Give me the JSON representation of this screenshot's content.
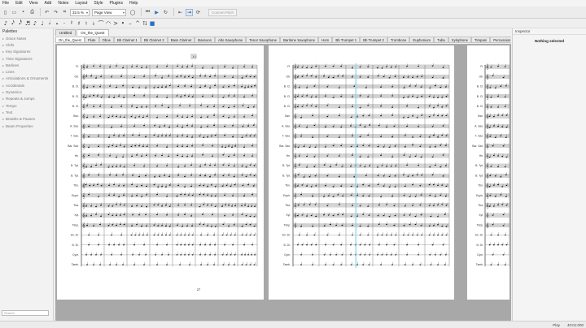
{
  "menu": [
    "File",
    "Edit",
    "View",
    "Add",
    "Notes",
    "Layout",
    "Style",
    "Plugins",
    "Help"
  ],
  "toolbar": {
    "zoom": "32.5 %",
    "view_mode": "Page View",
    "concert_pitch": "Concert Pitch"
  },
  "palette": {
    "title": "Palettes",
    "items": [
      "Grace Notes",
      "Clefs",
      "Key Signatures",
      "Time Signatures",
      "Barlines",
      "Lines",
      "Articulations & Ornaments",
      "Accidentals",
      "Dynamics",
      "Repeats & Jumps",
      "Tempo",
      "Text",
      "Breaths & Pauses",
      "Beam Properties"
    ],
    "search": "Search"
  },
  "score_tabs": [
    "Untitled",
    "On_the_Quest"
  ],
  "part_tabs": [
    "On_the_Quest",
    "Flute",
    "Oboe",
    "Bb Clarinet 1",
    "Bb Clarinet 2",
    "Bass Clarinet",
    "Bassoon",
    "Alto Saxophone",
    "Tenor Saxophone",
    "Baritone Saxophone",
    "Horn",
    "Bb Trumpet 1",
    "Bb Trumpet 2",
    "Trombone",
    "Euphonium",
    "Tuba",
    "Xylophone",
    "Timpani",
    "Percussion 2",
    "Percussion 3"
  ],
  "instruments": [
    "Fl.",
    "Ob.",
    "B. Cl.",
    "B. Cl.",
    "B. Cl.",
    "Bsn.",
    "A. Sax.",
    "T. Sax.",
    "Bar. Sax.",
    "Hn.",
    "B. Tpt.",
    "B. Tpt.",
    "Tbn.",
    "Euph.",
    "Tba.",
    "Xyl.",
    "Timp.",
    "Sn. Dr.",
    "B. Dr.",
    "Cym.",
    "Tamb."
  ],
  "page1_rehearsal": "30",
  "page1_number": "27",
  "inspector": {
    "title": "Inspector",
    "nothing_selected": "Nothing selected"
  },
  "status": {
    "mode": "Play",
    "position": "40:01:000"
  }
}
